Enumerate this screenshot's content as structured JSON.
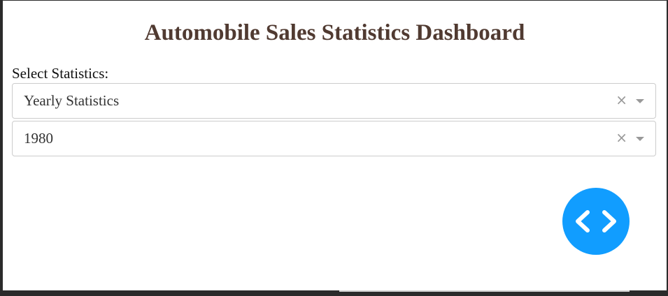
{
  "page": {
    "title": "Automobile Sales Statistics Dashboard"
  },
  "controls": {
    "select_label": "Select Statistics:",
    "statistics_dropdown": {
      "value": "Yearly Statistics",
      "clear_glyph": "×"
    },
    "year_dropdown": {
      "value": "1980",
      "clear_glyph": "×"
    }
  },
  "debug_button": {
    "icon": "code-brackets-icon",
    "color": "#119dff"
  },
  "colors": {
    "title": "#503a31",
    "accent": "#119dff"
  }
}
